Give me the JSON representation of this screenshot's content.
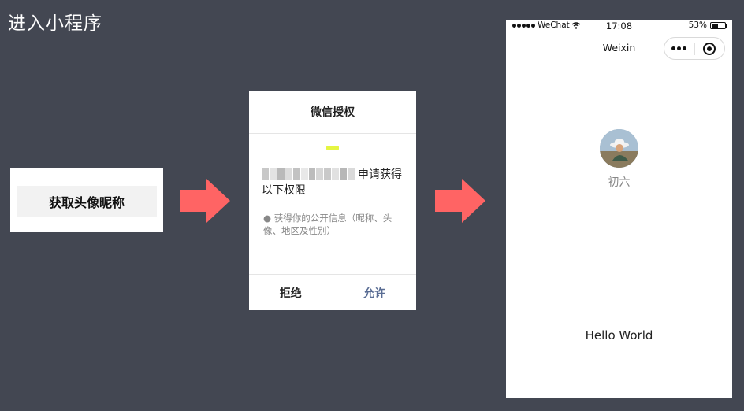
{
  "slide": {
    "title": "进入小程序"
  },
  "step1": {
    "button_label": "获取头像昵称"
  },
  "step2": {
    "dialog_title": "微信授权",
    "request_text": "申请获得以下权限",
    "permission_text": "● 获得你的公开信息（昵称、头像、地区及性别）",
    "deny_label": "拒绝",
    "allow_label": "允许",
    "accent_color": "#5a6d94"
  },
  "step3": {
    "status_bar": {
      "carrier": "WeChat",
      "time": "17:08",
      "battery_text": "53%",
      "battery_level": 0.53
    },
    "nav_title": "Weixin",
    "nickname": "初六",
    "hello_text": "Hello World"
  },
  "arrow_color": "#ff6464"
}
